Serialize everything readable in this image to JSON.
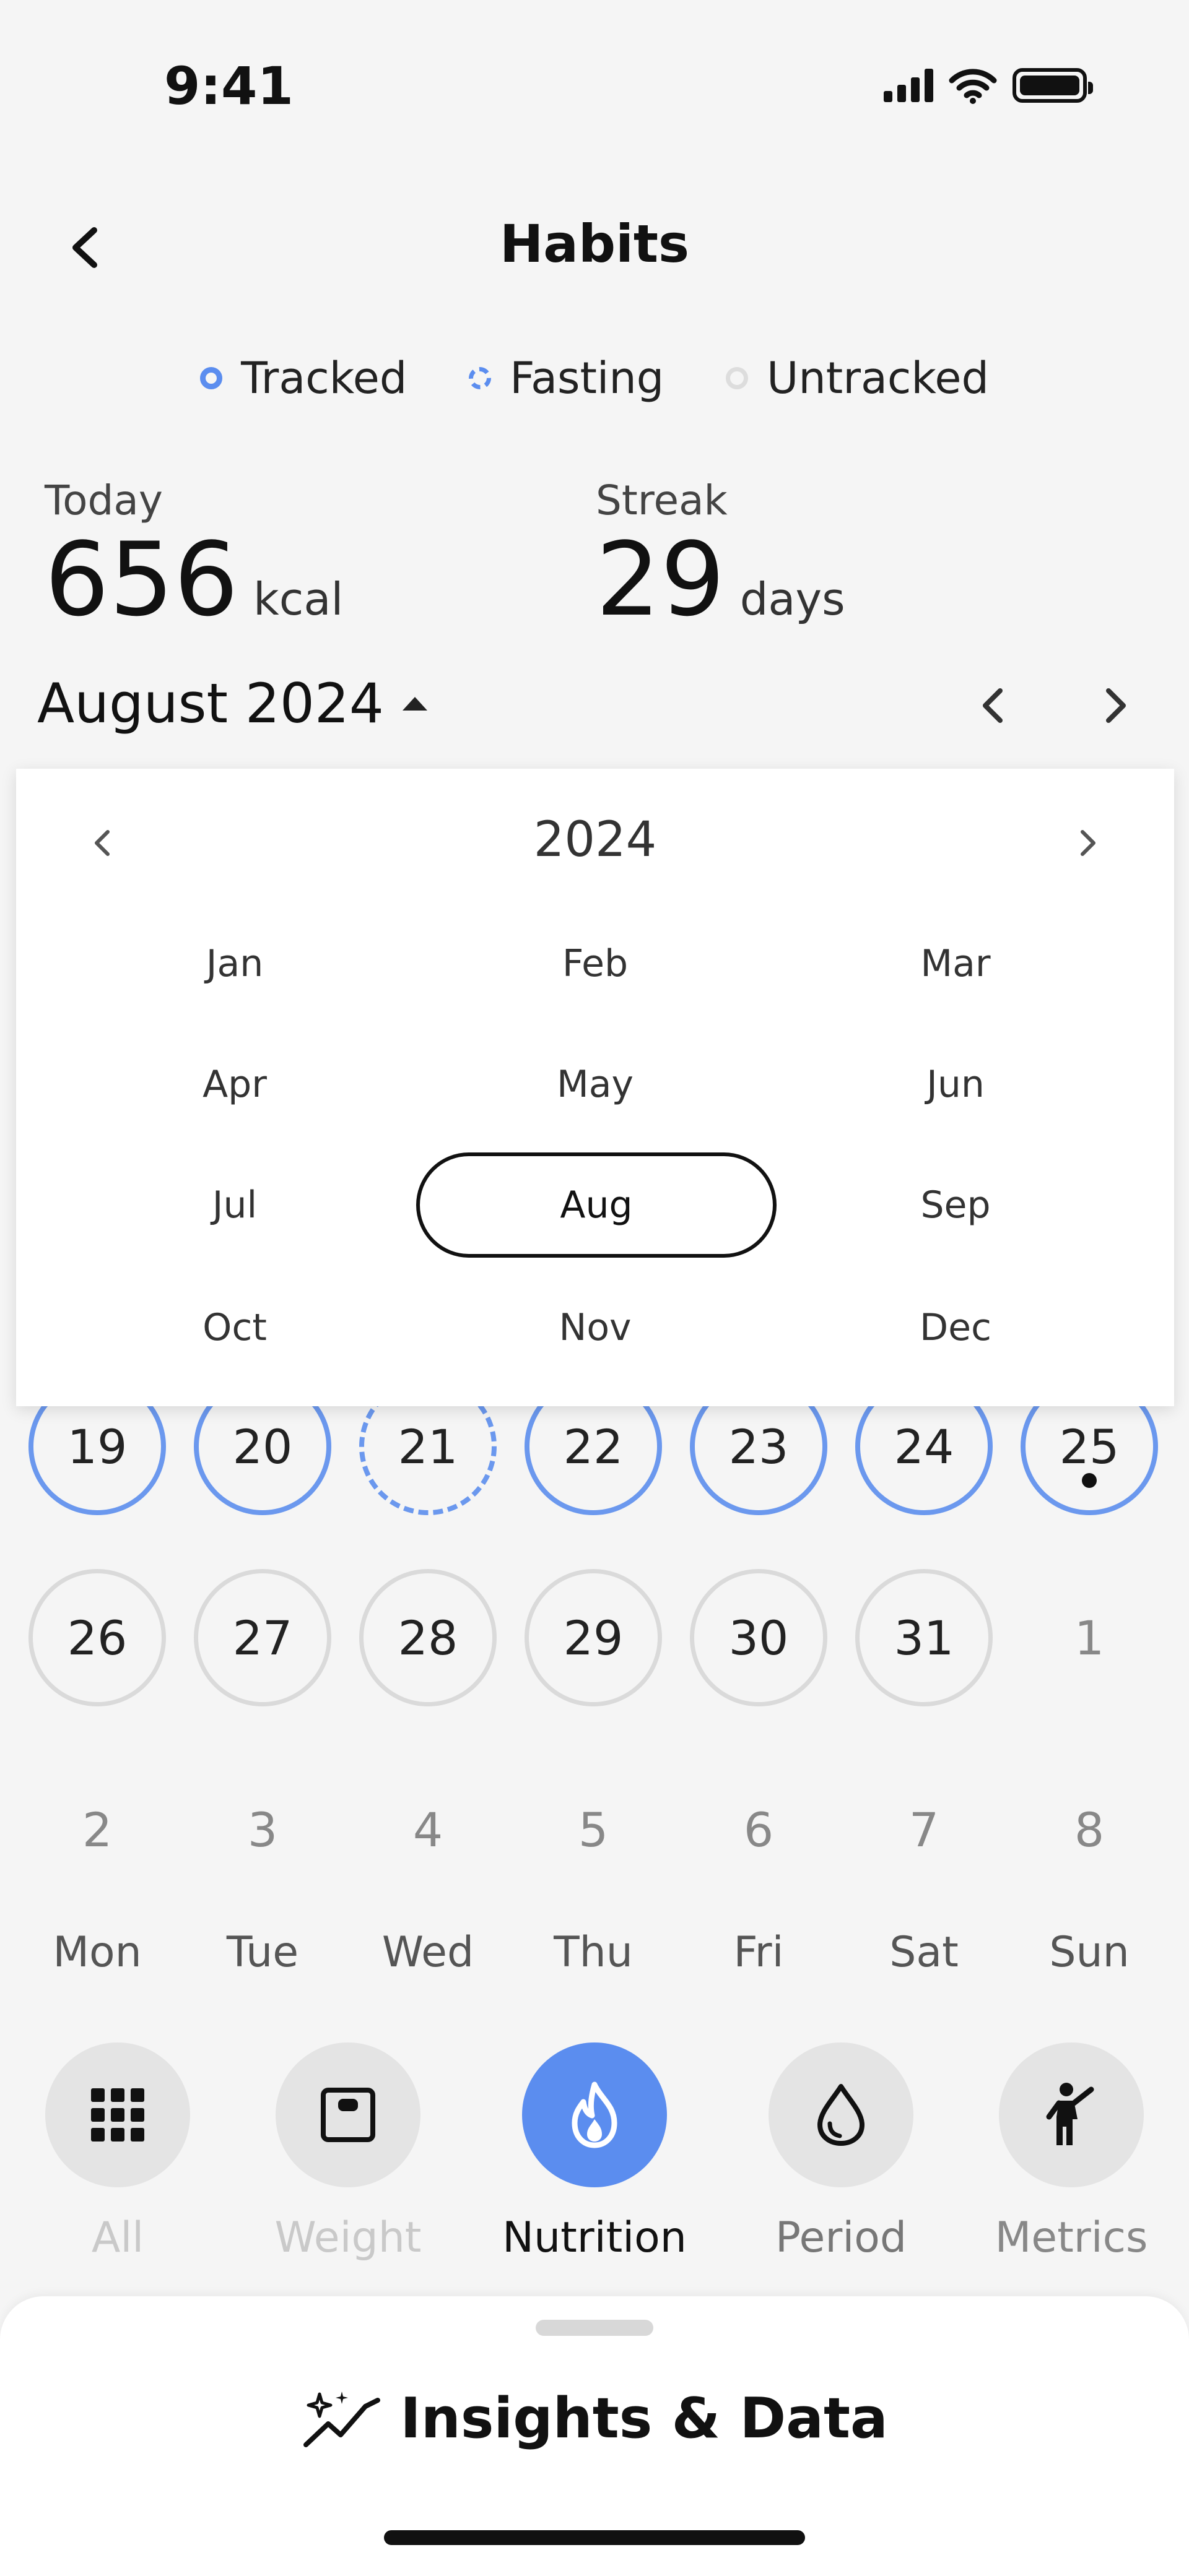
{
  "status": {
    "time": "9:41"
  },
  "header": {
    "title": "Habits"
  },
  "legend": [
    {
      "label": "Tracked",
      "style": "tracked"
    },
    {
      "label": "Fasting",
      "style": "fasting"
    },
    {
      "label": "Untracked",
      "style": "untracked"
    }
  ],
  "stats": {
    "today": {
      "label": "Today",
      "value": "656",
      "unit": "kcal"
    },
    "streak": {
      "label": "Streak",
      "value": "29",
      "unit": "days"
    }
  },
  "calendar": {
    "month_label": "August 2024",
    "rows": [
      [
        {
          "d": "19",
          "s": "tracked"
        },
        {
          "d": "20",
          "s": "tracked"
        },
        {
          "d": "21",
          "s": "fasting"
        },
        {
          "d": "22",
          "s": "tracked"
        },
        {
          "d": "23",
          "s": "tracked"
        },
        {
          "d": "24",
          "s": "tracked"
        },
        {
          "d": "25",
          "s": "tracked",
          "today": true
        }
      ],
      [
        {
          "d": "26",
          "s": "untracked"
        },
        {
          "d": "27",
          "s": "untracked"
        },
        {
          "d": "28",
          "s": "untracked"
        },
        {
          "d": "29",
          "s": "untracked"
        },
        {
          "d": "30",
          "s": "untracked"
        },
        {
          "d": "31",
          "s": "untracked"
        },
        {
          "d": "1",
          "s": "plain"
        }
      ],
      [
        {
          "d": "2",
          "s": "plain"
        },
        {
          "d": "3",
          "s": "plain"
        },
        {
          "d": "4",
          "s": "plain"
        },
        {
          "d": "5",
          "s": "plain"
        },
        {
          "d": "6",
          "s": "plain"
        },
        {
          "d": "7",
          "s": "plain"
        },
        {
          "d": "8",
          "s": "plain"
        }
      ]
    ],
    "weekdays": [
      "Mon",
      "Tue",
      "Wed",
      "Thu",
      "Fri",
      "Sat",
      "Sun"
    ]
  },
  "month_picker": {
    "year": "2024",
    "months": [
      "Jan",
      "Feb",
      "Mar",
      "Apr",
      "May",
      "Jun",
      "Jul",
      "Aug",
      "Sep",
      "Oct",
      "Nov",
      "Dec"
    ],
    "selected": "Aug"
  },
  "categories": [
    {
      "label": "All",
      "icon": "grid-icon",
      "label_color": "#c9c9c9"
    },
    {
      "label": "Weight",
      "icon": "scale-icon",
      "label_color": "#c9c9c9"
    },
    {
      "label": "Nutrition",
      "icon": "flame-icon",
      "label_color": "#111111",
      "active": true
    },
    {
      "label": "Period",
      "icon": "drop-icon",
      "label_color": "#777777"
    },
    {
      "label": "Metrics",
      "icon": "person-icon",
      "label_color": "#888888"
    }
  ],
  "bottom_sheet": {
    "title": "Insights & Data"
  },
  "colors": {
    "accent": "#5b8def",
    "tracked_ring": "#6b98ee",
    "untracked_ring": "#dadada"
  }
}
